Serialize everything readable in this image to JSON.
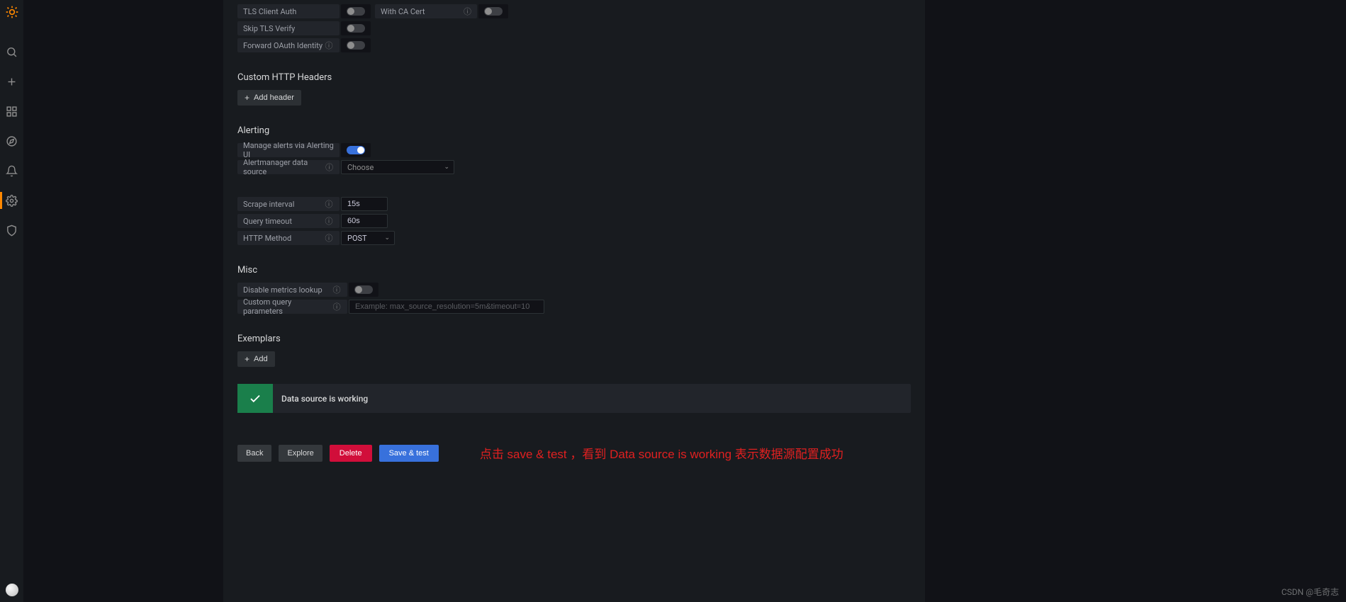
{
  "sidebar": {
    "active_index": 5
  },
  "auth": {
    "tls_client_label": "TLS Client Auth",
    "with_ca_label": "With CA Cert",
    "skip_verify_label": "Skip TLS Verify",
    "forward_oauth_label": "Forward OAuth Identity"
  },
  "headers": {
    "title": "Custom HTTP Headers",
    "add_label": "Add header"
  },
  "alerting": {
    "title": "Alerting",
    "manage_label": "Manage alerts via Alerting UI",
    "am_source_label": "Alertmanager data source",
    "am_source_value": "Choose",
    "scrape_label": "Scrape interval",
    "scrape_value": "15s",
    "timeout_label": "Query timeout",
    "timeout_value": "60s",
    "method_label": "HTTP Method",
    "method_value": "POST"
  },
  "misc": {
    "title": "Misc",
    "disable_lookup_label": "Disable metrics lookup",
    "custom_params_label": "Custom query parameters",
    "custom_params_placeholder": "Example: max_source_resolution=5m&timeout=10"
  },
  "exemplars": {
    "title": "Exemplars",
    "add_label": "Add"
  },
  "status": {
    "message": "Data source is working"
  },
  "buttons": {
    "back": "Back",
    "explore": "Explore",
    "delete": "Delete",
    "save": "Save & test"
  },
  "annotation": "点击 save & test ，看到 Data source is working 表示数据源配置成功",
  "watermark": "CSDN @毛奇志"
}
